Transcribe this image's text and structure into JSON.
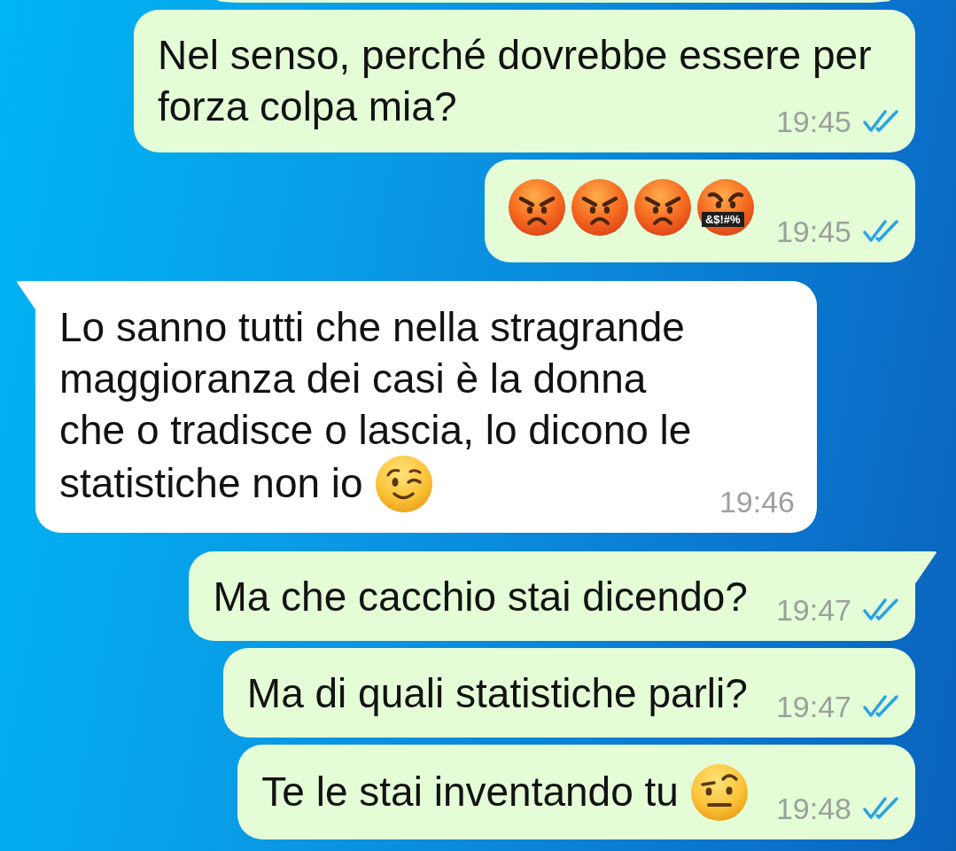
{
  "cut_off_bubble": {
    "kind": "sent"
  },
  "messages": [
    {
      "kind": "sent",
      "tail": false,
      "lines": [
        "Nel senso, perché dovrebbe essere per",
        "forza colpa mia?"
      ],
      "time": "19:45",
      "read": true
    },
    {
      "kind": "sent",
      "tail": false,
      "emojis": [
        {
          "kind": "angry"
        },
        {
          "kind": "angry"
        },
        {
          "kind": "angry"
        },
        {
          "kind": "cursing",
          "symbols": "&$!#%"
        }
      ],
      "time": "19:45",
      "read": true
    },
    {
      "kind": "received",
      "tail": true,
      "lines": [
        "Lo sanno tutti che nella stragrande",
        "maggioranza dei casi è la donna",
        "che o tradisce o lascia, lo dicono le",
        "statistiche non io"
      ],
      "emoji": {
        "kind": "wink"
      },
      "time": "19:46"
    },
    {
      "kind": "sent",
      "tail": true,
      "lines": [
        "Ma che cacchio stai dicendo?"
      ],
      "time": "19:47",
      "read": true
    },
    {
      "kind": "sent",
      "tail": false,
      "lines": [
        "Ma di quali statistiche parli?"
      ],
      "time": "19:47",
      "read": true
    },
    {
      "kind": "sent",
      "tail": false,
      "lines": [
        "Te le stai inventando tu"
      ],
      "emoji": {
        "kind": "raised_eyebrow"
      },
      "time": "19:48",
      "read": true
    }
  ]
}
